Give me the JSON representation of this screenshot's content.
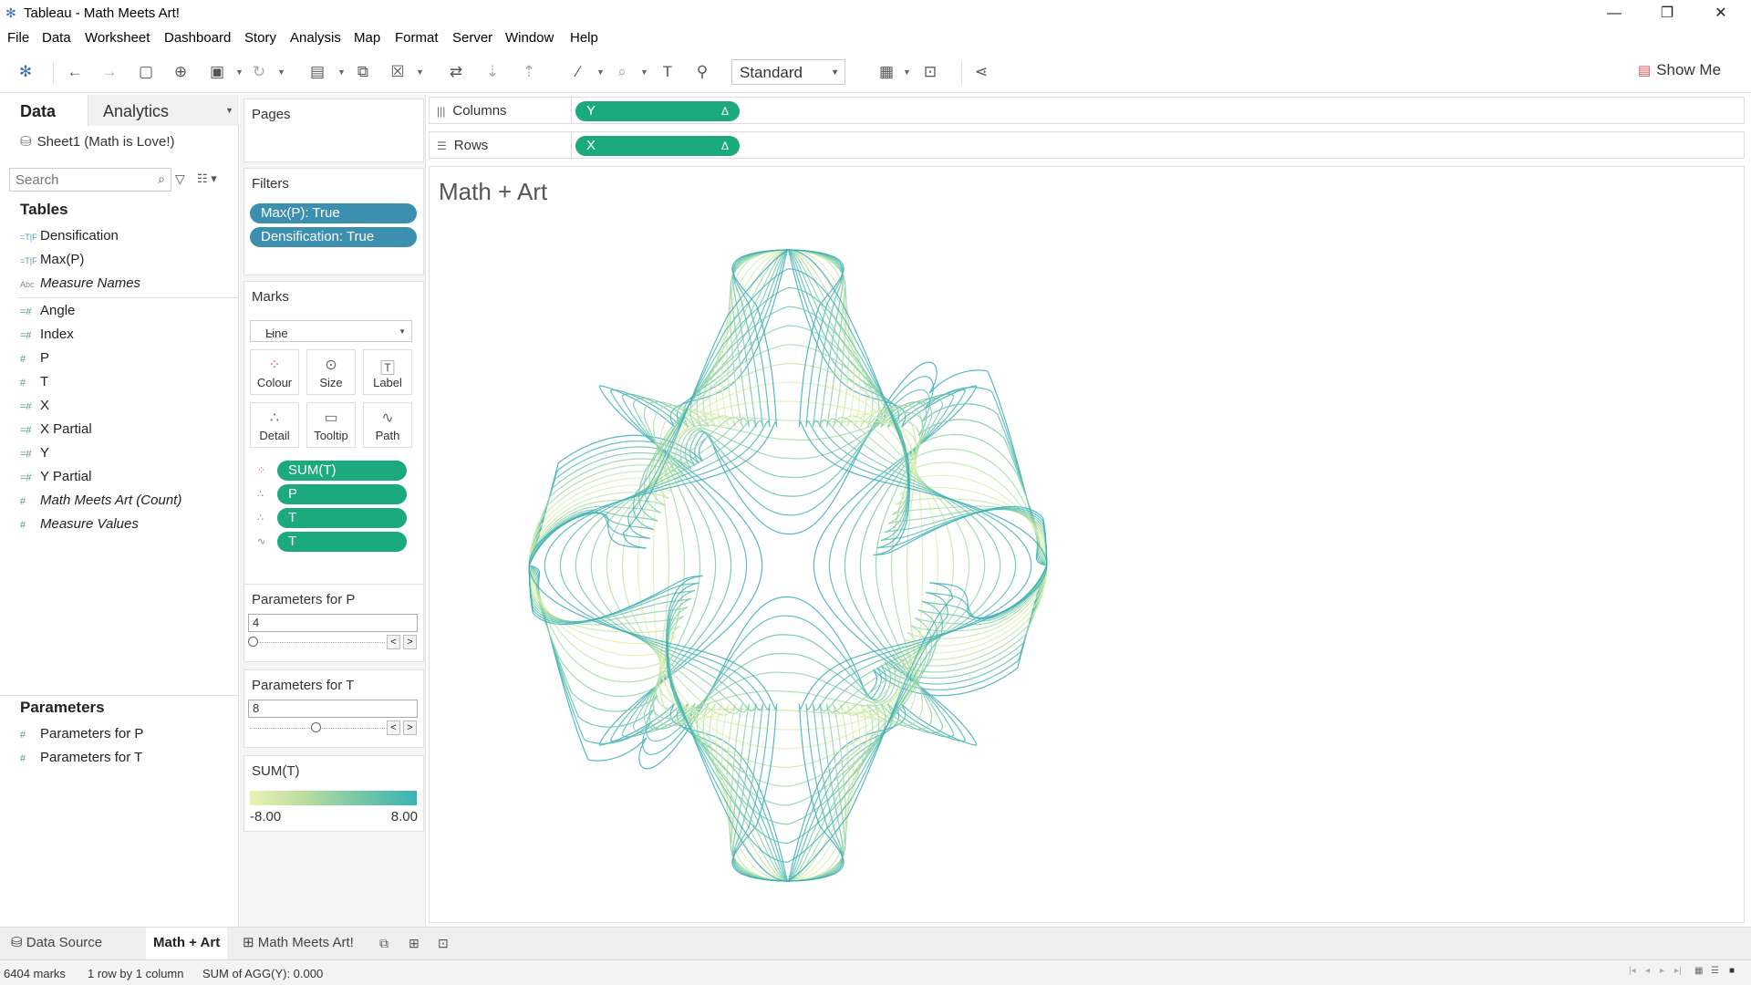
{
  "window": {
    "title": "Tableau - Math  Meets  Art!",
    "minimize": "—",
    "restore": "❐",
    "close": "✕"
  },
  "menu": [
    "File",
    "Data",
    "Worksheet",
    "Dashboard",
    "Story",
    "Analysis",
    "Map",
    "Format",
    "Server",
    "Window",
    "Help"
  ],
  "toolbar": {
    "fit_value": "Standard",
    "show_me": "Show Me"
  },
  "data_pane": {
    "tab_data": "Data",
    "tab_analytics": "Analytics",
    "datasource": "Sheet1 (Math is Love!)",
    "search_placeholder": "Search",
    "tables_heading": "Tables",
    "fields": [
      {
        "name": "Densification",
        "type": "dim"
      },
      {
        "name": "Max(P)",
        "type": "dim"
      },
      {
        "name": "Measure Names",
        "type": "abc",
        "italic": true
      },
      {
        "name": "Angle",
        "type": "measure"
      },
      {
        "name": "Index",
        "type": "measure"
      },
      {
        "name": "P",
        "type": "measure"
      },
      {
        "name": "T",
        "type": "measure"
      },
      {
        "name": "X",
        "type": "measure"
      },
      {
        "name": "X Partial",
        "type": "measure"
      },
      {
        "name": "Y",
        "type": "measure"
      },
      {
        "name": "Y Partial",
        "type": "measure"
      },
      {
        "name": "Math Meets Art (Count)",
        "type": "measure",
        "italic": true
      },
      {
        "name": "Measure Values",
        "type": "measure",
        "italic": true
      }
    ],
    "parameters_heading": "Parameters",
    "parameters": [
      "Parameters for P",
      "Parameters for T"
    ]
  },
  "shelves": {
    "pages": "Pages",
    "filters": "Filters",
    "filter_pills": [
      "Max(P): True",
      "Densification: True"
    ],
    "marks": "Marks",
    "mark_type": "Line",
    "mark_buttons": [
      "Colour",
      "Size",
      "Label",
      "Detail",
      "Tooltip",
      "Path"
    ],
    "mark_pills": [
      "SUM(T)",
      "P",
      "T",
      "T"
    ],
    "param_p_title": "Parameters for P",
    "param_p_value": "4",
    "param_t_title": "Parameters for T",
    "param_t_value": "8",
    "legend_title": "SUM(T)",
    "legend_min": "-8.00",
    "legend_max": "8.00",
    "columns_label": "Columns",
    "rows_label": "Rows",
    "columns_pill": "Y",
    "rows_pill": "X",
    "delta": "Δ"
  },
  "view": {
    "title": "Math + Art"
  },
  "sheet_tabs": {
    "data_source": "Data Source",
    "active": "Math + Art",
    "other": "Math Meets Art!"
  },
  "status": {
    "marks": "6404 marks",
    "dims": "1 row by 1 column",
    "sum": "SUM of AGG(Y): 0.000"
  },
  "colors": {
    "accent_green": "#1aaa7e",
    "filter_blue": "#3d8fb0",
    "legend_low": "#eaf2b4",
    "legend_high": "#3ab3b6"
  }
}
